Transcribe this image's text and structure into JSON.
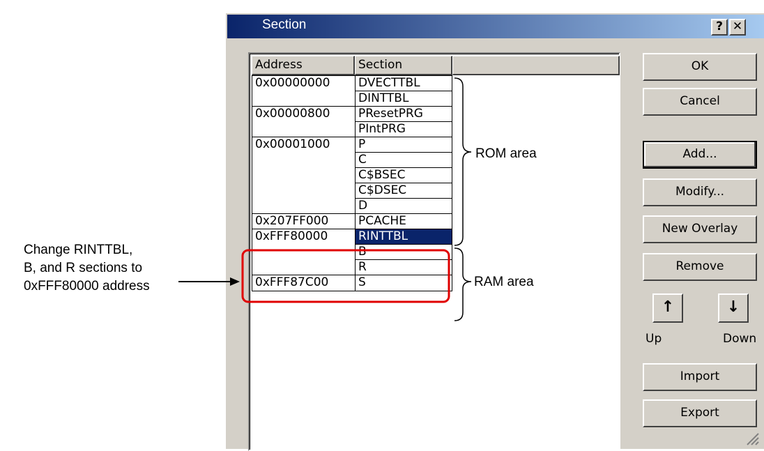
{
  "dialog": {
    "title": "Section",
    "help_glyph": "?",
    "close_glyph": "✕",
    "titlebar_colors": [
      "#0a246a",
      "#a6caf0"
    ]
  },
  "table": {
    "columns": [
      "Address",
      "Section"
    ],
    "rows": [
      {
        "address": "0x00000000",
        "section": "DVECTTBL"
      },
      {
        "address": "",
        "section": "DINTTBL"
      },
      {
        "address": "0x00000800",
        "section": "PResetPRG"
      },
      {
        "address": "",
        "section": "PIntPRG"
      },
      {
        "address": "0x00001000",
        "section": "P"
      },
      {
        "address": "",
        "section": "C"
      },
      {
        "address": "",
        "section": "C$BSEC"
      },
      {
        "address": "",
        "section": "C$DSEC"
      },
      {
        "address": "",
        "section": "D"
      },
      {
        "address": "0x207FF000",
        "section": "PCACHE"
      },
      {
        "address": "0xFFF80000",
        "section": "RINTTBL",
        "selected": true
      },
      {
        "address": "",
        "section": "B"
      },
      {
        "address": "",
        "section": "R"
      },
      {
        "address": "0xFFF87C00",
        "section": "S"
      }
    ]
  },
  "buttons": {
    "ok": "OK",
    "cancel": "Cancel",
    "add": "Add...",
    "modify": "Modify...",
    "new_overlay": "New Overlay",
    "remove": "Remove",
    "up_glyph": "↑",
    "down_glyph": "↓",
    "up": "Up",
    "down": "Down",
    "import": "Import",
    "export": "Export"
  },
  "annotations": {
    "note_lines": [
      "Change RINTTBL,",
      "B, and R sections to",
      "0xFFF80000 address"
    ],
    "rom_area": "ROM area",
    "ram_area": "RAM area",
    "highlight_color": "#e00000"
  }
}
